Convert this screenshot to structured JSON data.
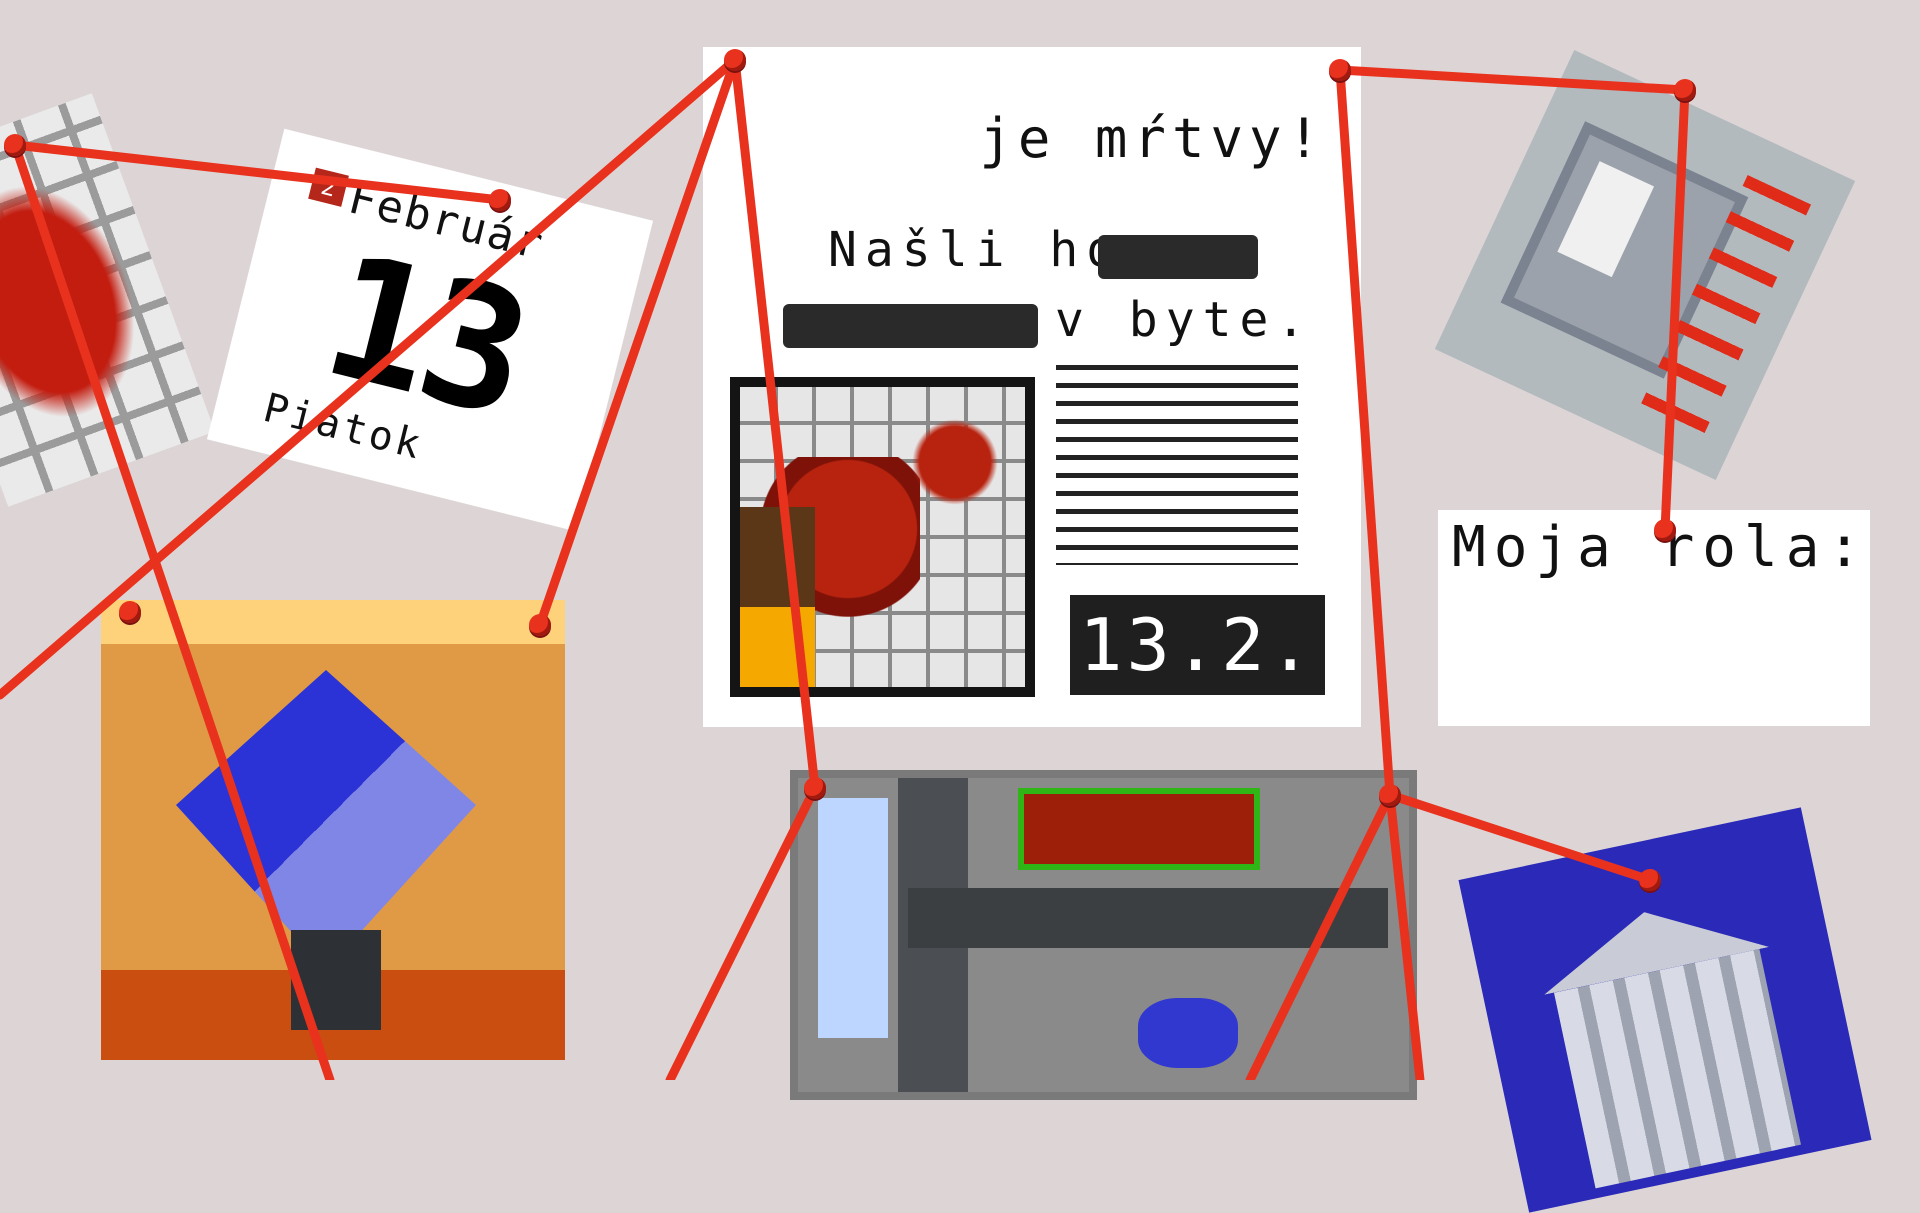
{
  "calendar": {
    "month_number": "2",
    "month": "Február",
    "day": "13",
    "weekday": "Piatok"
  },
  "newspaper": {
    "headline": "je mŕtvy!",
    "line1": "Našli ho",
    "line2": "v byte.",
    "date": "13.2."
  },
  "role_card": {
    "title": "Moja rola:"
  },
  "colors": {
    "background": "#ddd5d5",
    "string": "#e8321e",
    "pin": "#e8321e"
  },
  "icons": {
    "computer_card": "computer-icon",
    "blood_card": "blood-splatter-icon",
    "diamond_card": "diamond-icon",
    "map_card": "city-map-icon",
    "bank_card": "bank-building-icon"
  }
}
